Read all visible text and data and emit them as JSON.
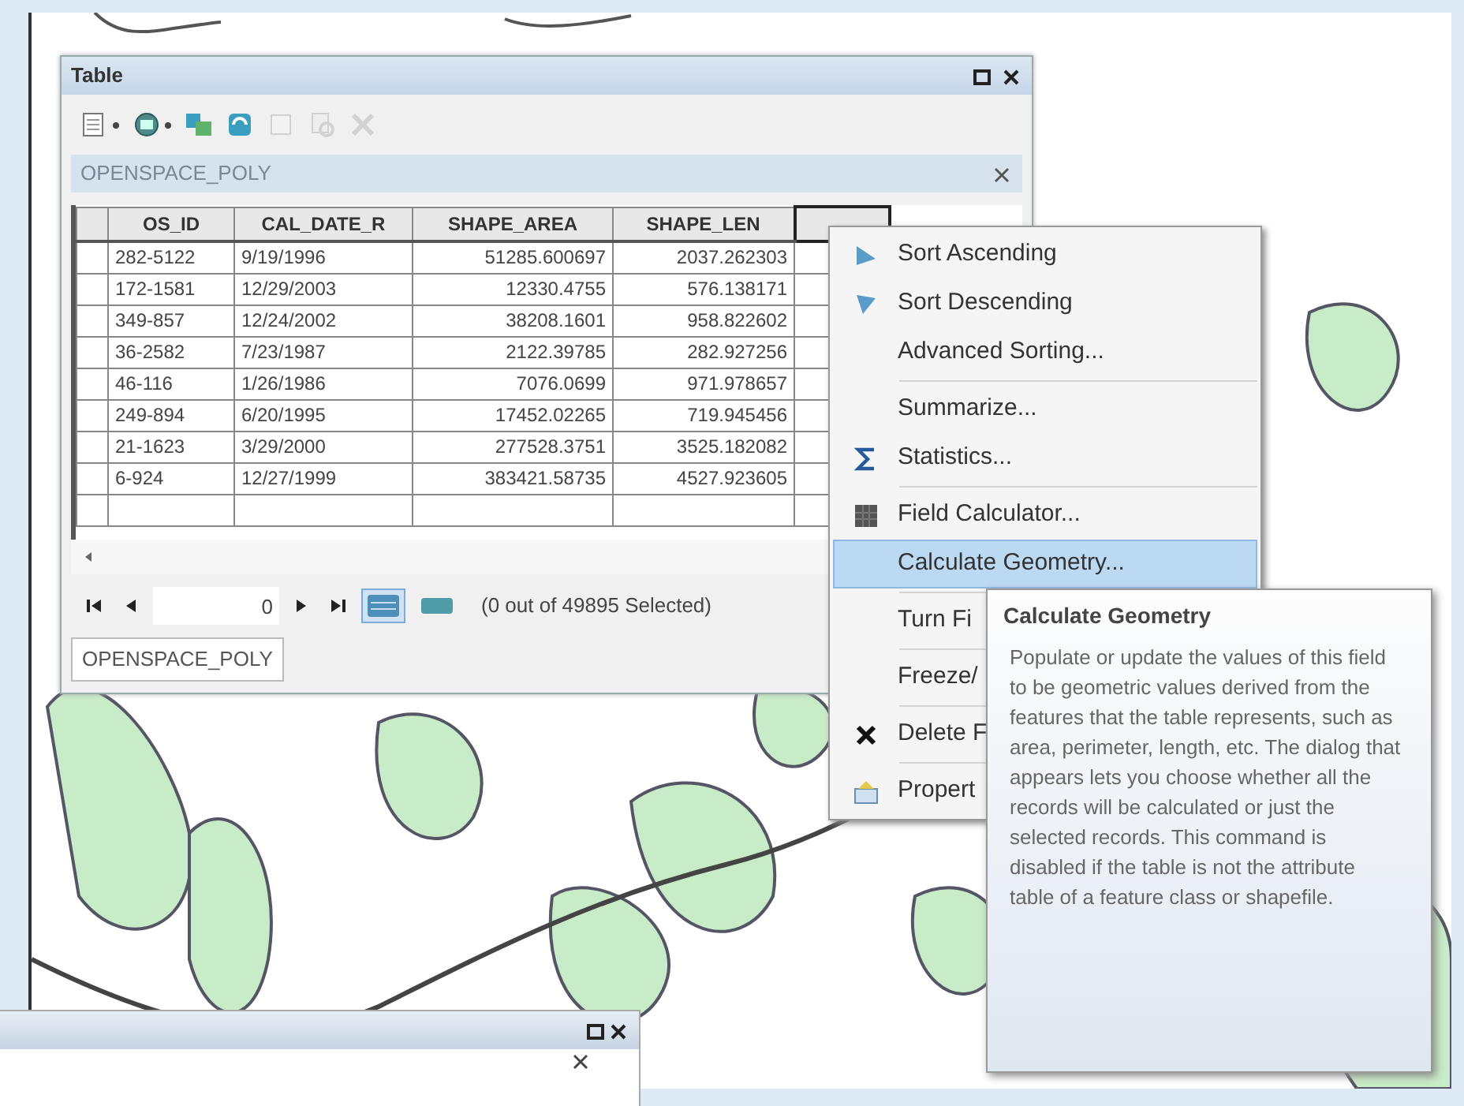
{
  "table_window": {
    "title": "Table",
    "toolbar": [
      {
        "kind": "table-options",
        "dropdown": true,
        "disabled": false
      },
      {
        "kind": "related-tables",
        "dropdown": true,
        "disabled": false
      },
      {
        "kind": "select-by-attributes",
        "dropdown": false,
        "disabled": false
      },
      {
        "kind": "switch-selection",
        "dropdown": false,
        "disabled": false
      },
      {
        "kind": "clear-selection",
        "dropdown": false,
        "disabled": true
      },
      {
        "kind": "zoom-to-selected",
        "dropdown": false,
        "disabled": true
      },
      {
        "kind": "delete-selected",
        "dropdown": false,
        "disabled": true
      }
    ],
    "tab_title": "OPENSPACE_POLY",
    "columns": [
      {
        "label": "OS_ID"
      },
      {
        "label": "CAL_DATE_R"
      },
      {
        "label": "SHAPE_AREA"
      },
      {
        "label": "SHAPE_LEN"
      }
    ],
    "column_5": {
      "selected": true
    },
    "rows": [
      [
        "282-5122",
        "9/19/1996",
        "51285.600697",
        "2037.262303"
      ],
      [
        "172-1581",
        "12/29/2003",
        "12330.4755",
        "576.138171"
      ],
      [
        "349-857",
        "12/24/2002",
        "38208.1601",
        "958.822602"
      ],
      [
        "36-2582",
        "7/23/1987",
        "2122.39785",
        "282.927256"
      ],
      [
        "46-116",
        "1/26/1986",
        "7076.0699",
        "971.978657"
      ],
      [
        "249-894",
        "6/20/1995",
        "17452.02265",
        "719.945456"
      ],
      [
        "21-1623",
        "3/29/2000",
        "277528.3751",
        "3525.182082"
      ],
      [
        "6-924",
        "12/27/1999",
        "383421.58735",
        "4527.923605"
      ]
    ],
    "navigator": {
      "value": "0",
      "status": "(0 out of 49895 Selected)",
      "views": [
        {
          "kind": "all-records",
          "selected": true
        },
        {
          "kind": "selected-records",
          "selected": false
        }
      ]
    },
    "bottom_tab": "OPENSPACE_POLY"
  },
  "context_menu": {
    "items": [
      {
        "label": "Sort Ascending",
        "kind": "sort-ascending",
        "highlighted": false,
        "separator_after": false
      },
      {
        "label": "Sort Descending",
        "kind": "sort-descending",
        "highlighted": false,
        "separator_after": false
      },
      {
        "label": "Advanced Sorting...",
        "kind": "plain",
        "highlighted": false,
        "separator_after": true
      },
      {
        "label": "Summarize...",
        "kind": "plain",
        "highlighted": false,
        "separator_after": false
      },
      {
        "label": "Statistics...",
        "kind": "statistics",
        "highlighted": false,
        "separator_after": true
      },
      {
        "label": "Field Calculator...",
        "kind": "calculator",
        "highlighted": false,
        "separator_after": false
      },
      {
        "label": "Calculate Geometry...",
        "kind": "plain",
        "highlighted": true,
        "separator_after": true
      },
      {
        "label": "Turn Fi",
        "kind": "plain",
        "highlighted": false,
        "separator_after": true
      },
      {
        "label": "Freeze/",
        "kind": "plain",
        "highlighted": false,
        "separator_after": true
      },
      {
        "label": "Delete F",
        "kind": "delete",
        "highlighted": false,
        "separator_after": true
      },
      {
        "label": "Propert",
        "kind": "properties",
        "highlighted": false,
        "separator_after": false
      }
    ]
  },
  "tooltip": {
    "title": "Calculate Geometry",
    "body": "Populate or update the values of this field to be geometric values derived from the features that the table represents, such as area, perimeter, length, etc. The dialog that appears lets you choose whether all the records will be calculated or just the selected records. This command is disabled if the table is not the attribute table of a feature class or shapefile."
  }
}
